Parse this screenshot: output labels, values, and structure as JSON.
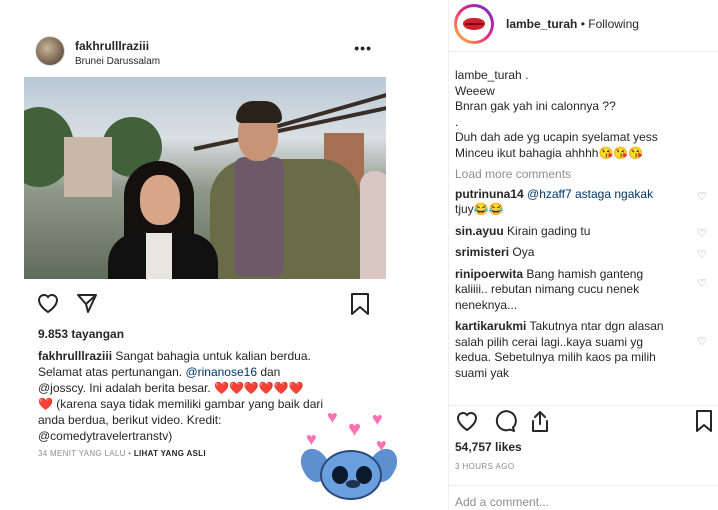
{
  "embedded_post": {
    "username": "fakhrulllraziii",
    "location": "Brunei Darussalam",
    "more_label": "•••",
    "views": "9.853 tayangan",
    "caption_lines": [
      [
        "fakhrulllraziii",
        " Sangat bahagia untuk kalian berdua."
      ],
      [
        "",
        "Selamat atas pertunangan. "
      ],
      [
        "",
        "@josscy. Ini adalah berita besar. ❤️❤️❤️❤️❤️❤️"
      ],
      [
        "",
        "❤️ (karena saya tidak memiliki gambar yang baik dari"
      ],
      [
        "",
        "anda berdua, berikut video. Kredit:"
      ],
      [
        "",
        "@comedytravelertranstv)"
      ]
    ],
    "caption_mention_1": "@rinanose16",
    "caption_mention_1_suffix": " dan",
    "time_ago": "34 MENIT YANG LALU",
    "time_sep": " • ",
    "see_original": "LIHAT YANG ASLI"
  },
  "post": {
    "username": "lambe_turah",
    "separator": " • ",
    "follow_state": "Following",
    "caption_user": "lambe_turah",
    "caption_lines": [
      ".",
      "Weeew",
      "Bnran gak yah ini calonnya ??",
      ".",
      "Duh dah ade yg ucapin syelamat yess",
      "Minceu ikut bahagia ahhhh😘😘😘"
    ],
    "load_more": "Load more comments",
    "comments": [
      {
        "user": "putrinuna14",
        "lines": [
          "@hzaff7 astaga ngakak",
          "tjuy😂😂"
        ]
      },
      {
        "user": "sin.ayuu",
        "lines": [
          "Kirain gading tu"
        ]
      },
      {
        "user": "srimisteri",
        "lines": [
          "Oya"
        ]
      },
      {
        "user": "rinipoerwita",
        "lines": [
          "Bang hamish ganteng",
          "kaliiii.. rebutan nimang cucu nenek",
          "neneknya..."
        ]
      },
      {
        "user": "kartikarukmi",
        "lines": [
          "Takutnya ntar dgn alasan",
          "salah pilih cerai lagi..kaya suami yg",
          "kedua. Sebetulnya milih kaos pa milih",
          "suami yak"
        ]
      }
    ],
    "likes": "54,757 likes",
    "time": "3 HOURS AGO",
    "add_comment_placeholder": "Add a comment..."
  }
}
